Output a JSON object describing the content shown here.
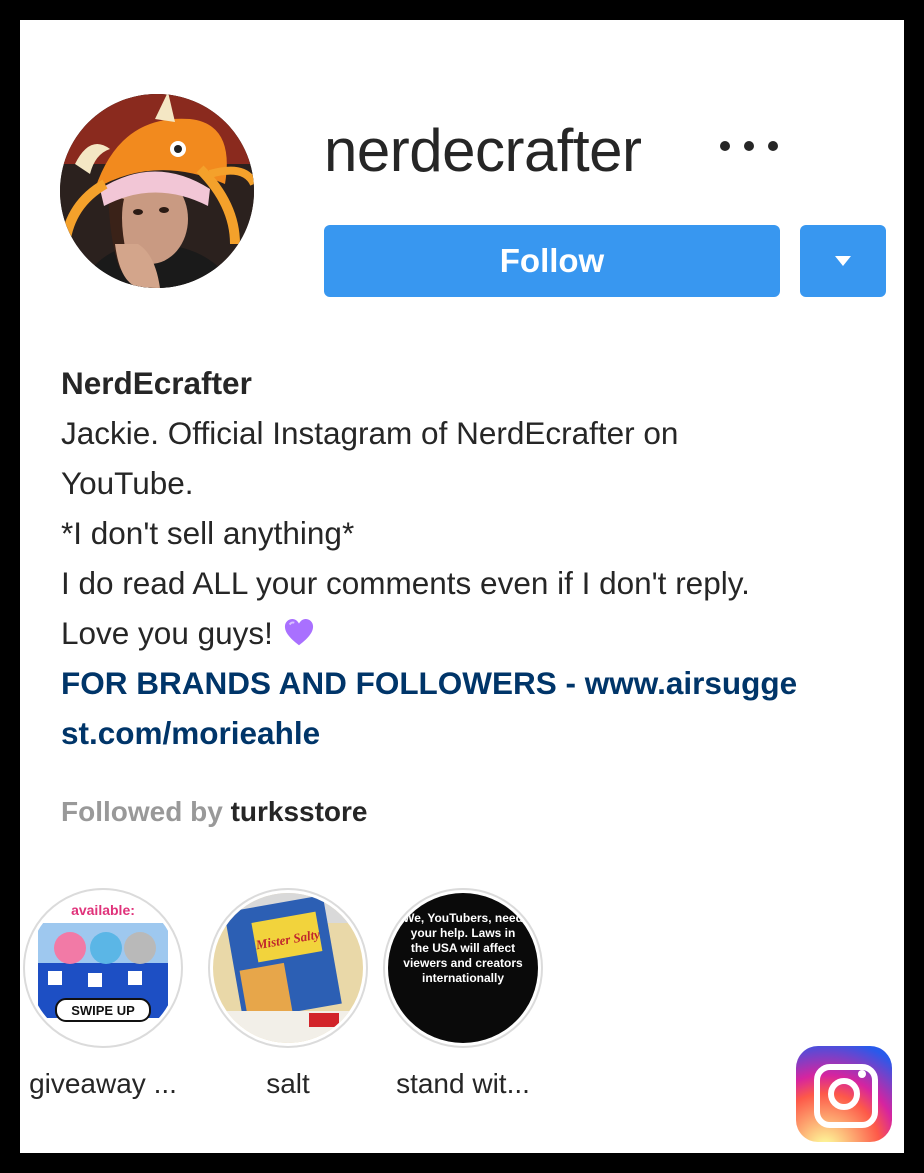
{
  "profile": {
    "username": "nerdecrafter",
    "follow_label": "Follow",
    "full_name": "NerdEcrafter",
    "bio_lines": [
      "Jackie. Official Instagram of NerdEcrafter on",
      "YouTube.",
      "*I don't sell anything*",
      "I do read ALL your comments even if I don't reply.",
      "Love you guys!"
    ],
    "link_lines": [
      "FOR BRANDS AND FOLLOWERS - www.airsugge",
      "st.com/morieahle"
    ],
    "followed_by_prefix": "Followed by",
    "followed_by_user": "turksstore"
  },
  "highlights": [
    {
      "label": "giveaway ...",
      "cover_text_top": "available:",
      "cover_text_bottom": "SWIPE UP"
    },
    {
      "label": "salt",
      "cover_text": "Mister Salty"
    },
    {
      "label": "stand wit...",
      "cover_text": "We, YouTubers, need your help. Laws in the USA will affect viewers and creators internationally"
    }
  ],
  "colors": {
    "follow_blue": "#3897f0",
    "link_blue": "#003569",
    "heart": "#a970ff",
    "text": "#262626",
    "muted": "#999999"
  },
  "icons": [
    "more-icon",
    "chevron-down-icon",
    "purple-heart-icon",
    "instagram-logo-icon"
  ]
}
